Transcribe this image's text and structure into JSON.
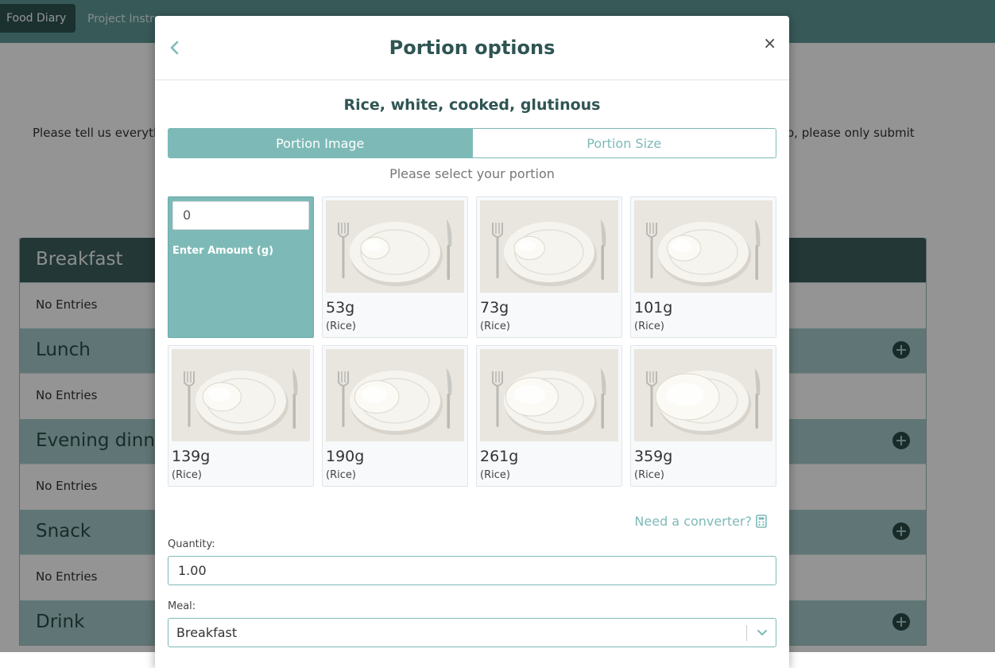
{
  "nav": {
    "active_tab": "Food Diary",
    "other_tab": "Project Instru"
  },
  "page": {
    "intro_left": "Please tell us everyth",
    "intro_right": "o, please only submit"
  },
  "meals": [
    {
      "name": "Breakfast",
      "entries": "No Entries"
    },
    {
      "name": "Lunch",
      "entries": "No Entries"
    },
    {
      "name": "Evening dinne",
      "entries": "No Entries"
    },
    {
      "name": "Snack",
      "entries": "No Entries"
    },
    {
      "name": "Drink",
      "entries": ""
    }
  ],
  "modal": {
    "title": "Portion options",
    "close_symbol": "×",
    "food_name": "Rice, white, cooked, glutinous",
    "tabs": [
      "Portion Image",
      "Portion Size"
    ],
    "select_hint": "Please select your portion",
    "amount_value": "0",
    "amount_label": "Enter Amount (g)",
    "portions": [
      {
        "weight": "53g",
        "food": "(Rice)",
        "fill": 0.15
      },
      {
        "weight": "73g",
        "food": "(Rice)",
        "fill": 0.2
      },
      {
        "weight": "101g",
        "food": "(Rice)",
        "fill": 0.28
      },
      {
        "weight": "139g",
        "food": "(Rice)",
        "fill": 0.39
      },
      {
        "weight": "190g",
        "food": "(Rice)",
        "fill": 0.53
      },
      {
        "weight": "261g",
        "food": "(Rice)",
        "fill": 0.73
      },
      {
        "weight": "359g",
        "food": "(Rice)",
        "fill": 1.0
      }
    ],
    "converter_link": "Need a converter?",
    "quantity_label": "Quantity:",
    "quantity_value": "1.00",
    "meal_label": "Meal:",
    "meal_value": "Breakfast"
  },
  "colors": {
    "accent": "#7dbab7",
    "nav_bg": "#5f9b98",
    "title_text": "#2f5553"
  }
}
